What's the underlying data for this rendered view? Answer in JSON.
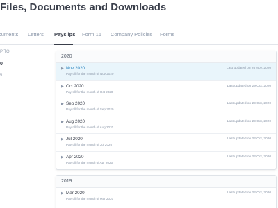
{
  "page": {
    "title": "Files, Documents and Downloads"
  },
  "tabs": [
    {
      "label": "cuments"
    },
    {
      "label": "Letters"
    },
    {
      "label": "Payslips",
      "active": true
    },
    {
      "label": "Form 16"
    },
    {
      "label": "Company Policies"
    },
    {
      "label": "Forms"
    }
  ],
  "sidebar": {
    "jump_label": "P TO",
    "year": "0",
    "other": "9"
  },
  "sections": [
    {
      "year": "2020",
      "items": [
        {
          "title": "Nov 2020",
          "subtitle": "Payroll for the month of Nov 2020",
          "updated": "Last updated on 26 Nov, 2020",
          "highlight": true
        },
        {
          "title": "Oct 2020",
          "subtitle": "Payroll for the month of Oct 2020",
          "updated": "Last updated on 29 Oct, 2020"
        },
        {
          "title": "Sep 2020",
          "subtitle": "Payroll for the month of Sep 2020",
          "updated": "Last updated on 29 Oct, 2020"
        },
        {
          "title": "Aug 2020",
          "subtitle": "Payroll for the month of Aug 2020",
          "updated": "Last updated on 29 Oct, 2020"
        },
        {
          "title": "Jul 2020",
          "subtitle": "Payroll for the month of Jul 2020",
          "updated": "Last updated on 22 Oct, 2020"
        },
        {
          "title": "Apr 2020",
          "subtitle": "Payroll for the month of Apr 2020",
          "updated": "Last updated on 22 Oct, 2020"
        }
      ]
    },
    {
      "year": "2019",
      "items": [
        {
          "title": "Mar 2020",
          "subtitle": "Payroll for the month of Mar 2020",
          "updated": "Last updated on 22 Oct, 2020"
        }
      ]
    }
  ]
}
